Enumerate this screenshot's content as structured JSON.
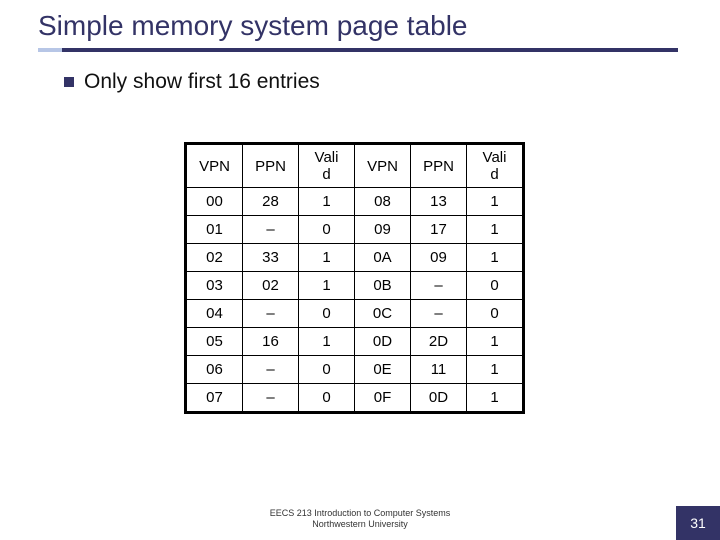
{
  "title": "Simple memory system page table",
  "bullet": "Only show first 16 entries",
  "headers": [
    "VPN",
    "PPN",
    "Vali\nd",
    "VPN",
    "PPN",
    "Vali\nd"
  ],
  "chart_data": {
    "type": "table",
    "columns": [
      "VPN",
      "PPN",
      "Valid",
      "VPN",
      "PPN",
      "Valid"
    ],
    "rows": [
      [
        "00",
        "28",
        "1",
        "08",
        "13",
        "1"
      ],
      [
        "01",
        "–",
        "0",
        "09",
        "17",
        "1"
      ],
      [
        "02",
        "33",
        "1",
        "0A",
        "09",
        "1"
      ],
      [
        "03",
        "02",
        "1",
        "0B",
        "–",
        "0"
      ],
      [
        "04",
        "–",
        "0",
        "0C",
        "–",
        "0"
      ],
      [
        "05",
        "16",
        "1",
        "0D",
        "2D",
        "1"
      ],
      [
        "06",
        "–",
        "0",
        "0E",
        "11",
        "1"
      ],
      [
        "07",
        "–",
        "0",
        "0F",
        "0D",
        "1"
      ]
    ]
  },
  "footer_line1": "EECS 213 Introduction to Computer Systems",
  "footer_line2": "Northwestern University",
  "page_number": "31"
}
